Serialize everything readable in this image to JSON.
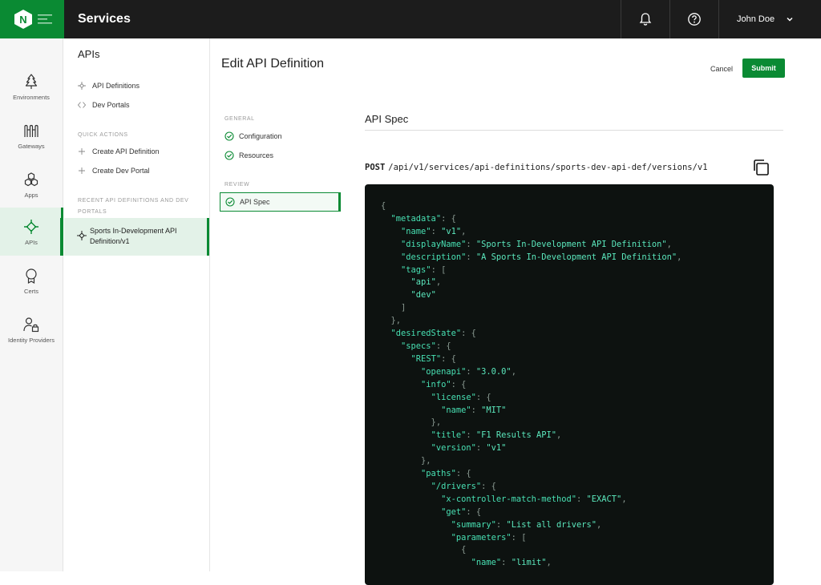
{
  "topbar": {
    "title": "Services",
    "user_name": "John Doe",
    "logo_letter": "N",
    "colors": {
      "background": "#1c1c1c",
      "brand": "#0a8a33"
    }
  },
  "icon_nav": {
    "items": [
      {
        "label": "Environments",
        "icon": "tree-icon",
        "active": false
      },
      {
        "label": "Gateways",
        "icon": "gateway-icon",
        "active": false
      },
      {
        "label": "Apps",
        "icon": "apps-icon",
        "active": false
      },
      {
        "label": "APIs",
        "icon": "api-icon",
        "active": true
      },
      {
        "label": "Certs",
        "icon": "certificate-icon",
        "active": false
      },
      {
        "label": "Identity Providers",
        "icon": "identity-provider-icon",
        "active": false
      }
    ]
  },
  "sub_nav": {
    "title": "APIs",
    "items": [
      {
        "label": "API Definitions",
        "icon": "api-definitions-icon"
      },
      {
        "label": "Dev Portals",
        "icon": "code-brackets-icon"
      }
    ],
    "quick_actions_heading": "QUICK ACTIONS",
    "quick_actions": [
      {
        "label": "Create API Definition",
        "icon": "plus-icon"
      },
      {
        "label": "Create Dev Portal",
        "icon": "plus-icon"
      }
    ],
    "recent_heading": "RECENT API DEFINITIONS AND DEV PORTALS",
    "recent_item": "Sports In-Development API Definition/v1"
  },
  "main": {
    "title": "Edit API Definition",
    "cancel_label": "Cancel",
    "submit_label": "Submit",
    "steps_general_heading": "GENERAL",
    "steps_general": [
      {
        "label": "Configuration",
        "done": true
      },
      {
        "label": "Resources",
        "done": true
      }
    ],
    "steps_review_heading": "REVIEW",
    "steps_review": [
      {
        "label": "API Spec",
        "done": true,
        "active": true
      }
    ],
    "spec_title": "API Spec",
    "endpoint_method": "POST",
    "endpoint_path": "/api/v1/services/api-definitions/sports-dev-api-def/versions/v1"
  },
  "code_lines": [
    "{",
    "  \"metadata\": {",
    "    \"name\": \"v1\",",
    "    \"displayName\": \"Sports In-Development API Definition\",",
    "    \"description\": \"A Sports In-Development API Definition\",",
    "    \"tags\": [",
    "      \"api\",",
    "      \"dev\"",
    "    ]",
    "  },",
    "  \"desiredState\": {",
    "    \"specs\": {",
    "      \"REST\": {",
    "        \"openapi\": \"3.0.0\",",
    "        \"info\": {",
    "          \"license\": {",
    "            \"name\": \"MIT\"",
    "          },",
    "          \"title\": \"F1 Results API\",",
    "          \"version\": \"v1\"",
    "        },",
    "        \"paths\": {",
    "          \"/drivers\": {",
    "            \"x-controller-match-method\": \"EXACT\",",
    "            \"get\": {",
    "              \"summary\": \"List all drivers\",",
    "              \"parameters\": [",
    "                {",
    "                  \"name\": \"limit\","
  ]
}
